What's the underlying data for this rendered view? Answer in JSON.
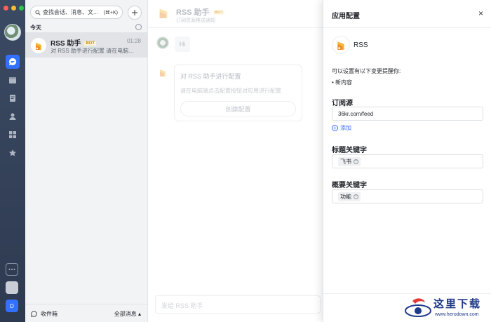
{
  "sidebar": {
    "bottom_user_initial": "D"
  },
  "chat_list": {
    "search_placeholder": "查找会话、消息、文...",
    "search_hotkey": "(⌘+K)",
    "section_label": "今天",
    "chat": {
      "name": "RSS 助手",
      "badge": "BOT",
      "time": "01:28",
      "preview": "对 RSS 助手进行配置 请在电脑端点..."
    },
    "footer_inbox": "收件箱",
    "footer_all": "全部消息 ▴"
  },
  "conversation": {
    "title": "RSS 助手",
    "badge": "BOT",
    "subtitle": "订阅信源推送通知",
    "hi_message": "Hi",
    "card": {
      "title": "对 RSS 助手进行配置",
      "description": "请在电脑端点击配置按钮对应用进行配置",
      "button": "创建配置"
    },
    "composer_placeholder": "发给 RSS 助手"
  },
  "panel": {
    "title": "应用配置",
    "close": "×",
    "app_name": "RSS",
    "reminder_text": "可以设置有以下变更提醒你:",
    "reminder_item": "• 新内容",
    "feed_label": "订阅源",
    "feed_value": "36kr.com/feed",
    "add_label": "添加",
    "title_keyword_label": "标题关键字",
    "title_keyword_tag": "飞书",
    "summary_keyword_label": "概要关键字",
    "summary_keyword_tag": "功能"
  },
  "watermark": {
    "cn": "这里下载",
    "en": "www.herodown.com"
  },
  "colors": {
    "accent": "#3370ff",
    "rail": "#3b4a63",
    "bot_badge": "#d18b00"
  }
}
